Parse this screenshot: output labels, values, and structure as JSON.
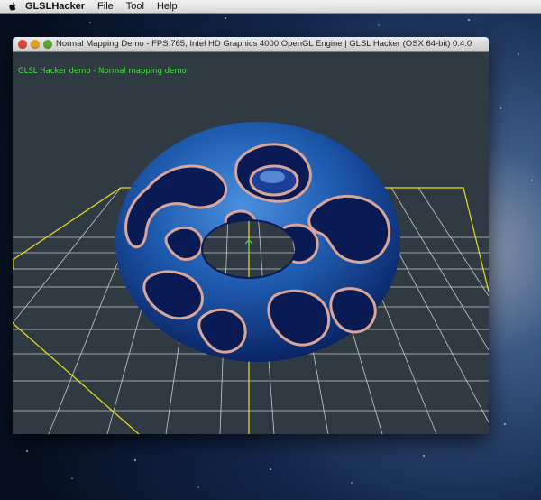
{
  "menubar": {
    "app_name": "GLSLHacker",
    "items": [
      "File",
      "Tool",
      "Help"
    ]
  },
  "window": {
    "title": "Normal Mapping Demo - FPS:765, Intel HD Graphics 4000 OpenGL Engine | GLSL Hacker (OSX 64-bit) 0.4.0",
    "demo_label": "GLSL Hacker demo - Normal mapping demo"
  },
  "colors": {
    "viewport_bg": "#303a42",
    "grid_white": "#e6e6e6",
    "grid_yellow": "#e8e21a",
    "torus_blue": "#2a6fc4",
    "label_green": "#49e046"
  },
  "icons": [
    "apple-icon",
    "close-icon",
    "minimize-icon",
    "zoom-icon"
  ]
}
